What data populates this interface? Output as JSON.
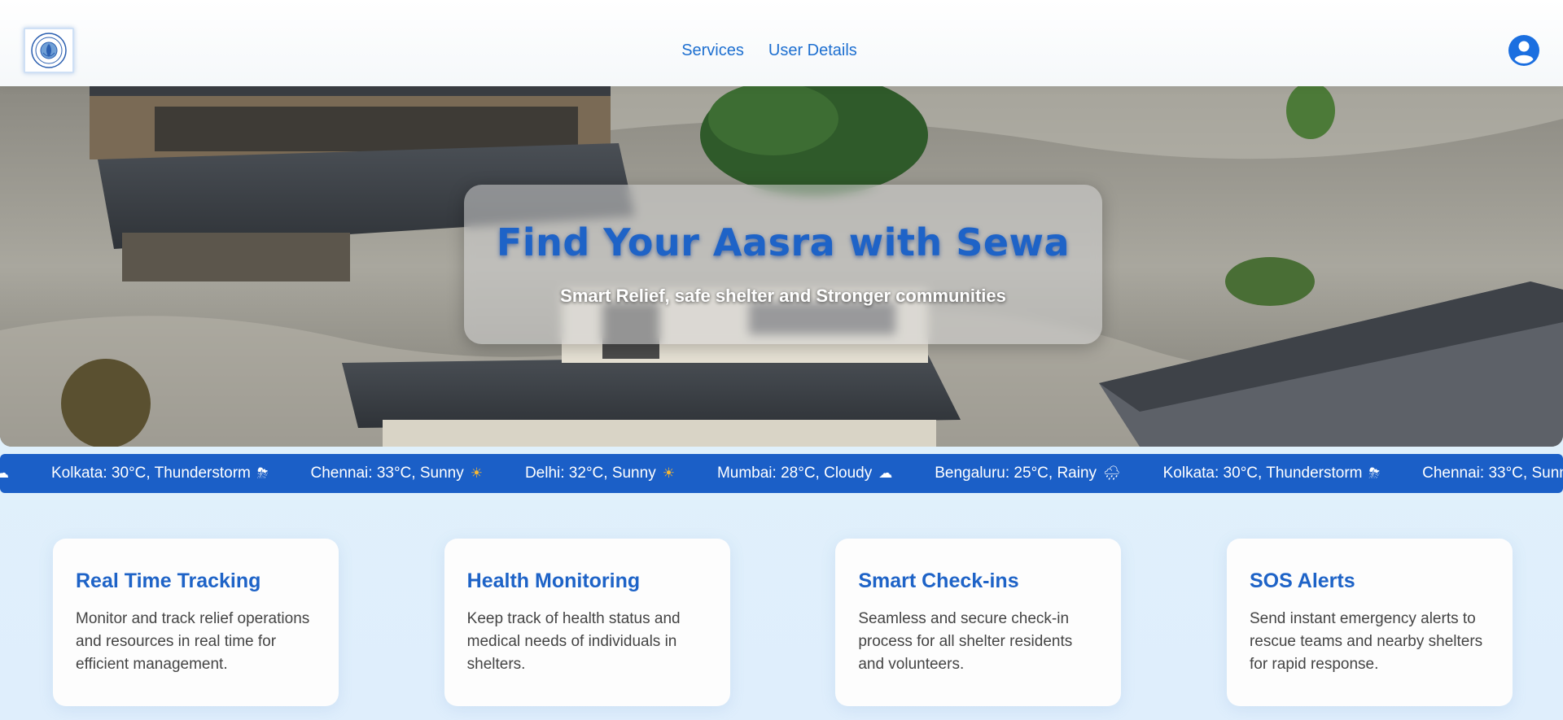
{
  "header": {
    "logo_icon": "organization-seal-logo",
    "nav": [
      {
        "label": "Services"
      },
      {
        "label": "User Details"
      }
    ],
    "profile_icon": "user-profile-icon"
  },
  "hero": {
    "title": "Find Your Aasra with Sewa",
    "subtitle": "Smart Relief, safe shelter and Stronger communities",
    "background": "flooded-houses-photo"
  },
  "ticker": {
    "items": [
      {
        "text": "Kolkata: 30°C, Thunderstorm",
        "icon": "⛈"
      },
      {
        "text": "Chennai: 33°C, Sunny",
        "icon": "☀"
      },
      {
        "text": "Delhi: 32°C, Sunny",
        "icon": "☀"
      },
      {
        "text": "Mumbai: 28°C, Cloudy",
        "icon": "☁"
      },
      {
        "text": "Bengaluru: 25°C, Rainy",
        "icon": "🌧"
      },
      {
        "text": "Kolkata: 30°C, Thunderstorm",
        "icon": "⛈"
      },
      {
        "text": "Chennai: 33°C, Sunny",
        "icon": "☀"
      }
    ]
  },
  "cards": [
    {
      "title": "Real Time Tracking",
      "text": "Monitor and track relief operations and resources in real time for efficient management."
    },
    {
      "title": "Health Monitoring",
      "text": "Keep track of health status and medical needs of individuals in shelters."
    },
    {
      "title": "Smart Check-ins",
      "text": "Seamless and secure check-in process for all shelter residents and volunteers."
    },
    {
      "title": "SOS Alerts",
      "text": "Send instant emergency alerts to rescue teams and nearby shelters for rapid response."
    }
  ],
  "colors": {
    "accent": "#1e63c7",
    "ticker_bg": "#1b5fc7",
    "nav_link": "#1d6fd0"
  }
}
